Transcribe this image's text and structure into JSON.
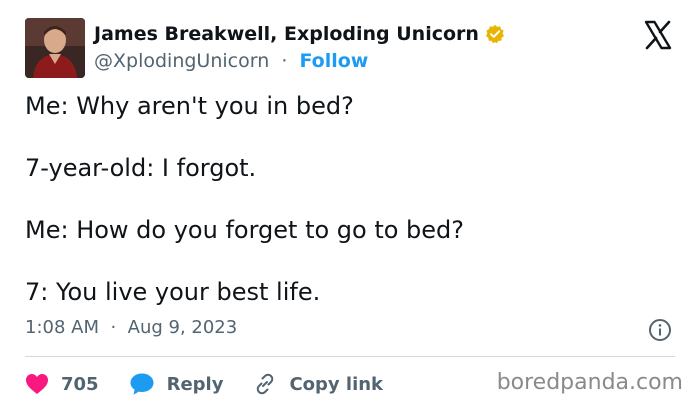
{
  "author": {
    "name": "James Breakwell, Exploding Unicorn",
    "handle": "@XplodingUnicorn",
    "separator": "·",
    "follow_label": "Follow",
    "verified_color": "#e8b400"
  },
  "tweet": {
    "paragraphs": [
      "Me: Why aren't you in bed?",
      "7-year-old: I forgot.",
      "Me: How do you forget to go to bed?",
      "7: You live your best life."
    ],
    "time": "1:08 AM",
    "meta_separator": "·",
    "date": "Aug 9, 2023"
  },
  "actions": {
    "like_count": "705",
    "reply_label": "Reply",
    "copy_link_label": "Copy link"
  },
  "icons": {
    "avatar": "avatar-photo",
    "verified": "verified-badge-icon",
    "brand": "x-logo-icon",
    "info": "info-icon",
    "like": "heart-icon",
    "reply": "speech-bubble-icon",
    "copy": "link-icon"
  },
  "colors": {
    "like": "#f91880",
    "reply": "#1d9bf0",
    "link": "#1d9bf0",
    "text": "#0f1419",
    "muted": "#536471"
  },
  "watermark": "boredpanda.com"
}
